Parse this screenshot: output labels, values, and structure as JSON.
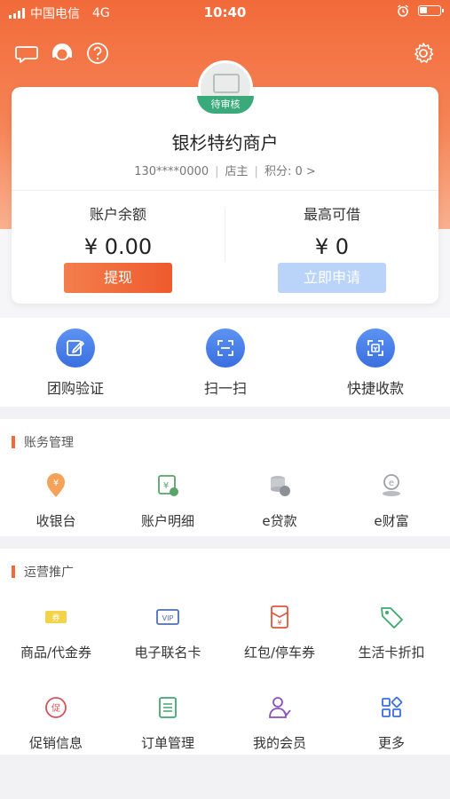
{
  "status_bar": {
    "carrier": "中国电信",
    "network": "4G",
    "time": "10:40"
  },
  "merchant": {
    "badge": "待审核",
    "name": "银杉特约商户",
    "phone": "130****0000",
    "role": "店主",
    "points": "积分: 0 >"
  },
  "balance": {
    "account_label": "账户余额",
    "account_value": "¥ 0.00",
    "withdraw_label": "提现",
    "credit_label": "最高可借",
    "credit_value": "¥ 0",
    "apply_label": "立即申请"
  },
  "quick_actions": [
    {
      "label": "团购验证",
      "icon": "edit-icon"
    },
    {
      "label": "扫一扫",
      "icon": "scan-icon"
    },
    {
      "label": "快捷收款",
      "icon": "qr-pay-icon"
    }
  ],
  "finance": {
    "title": "账务管理",
    "items": [
      {
        "label": "收银台",
        "icon": "cashier-icon"
      },
      {
        "label": "账户明细",
        "icon": "account-detail-icon"
      },
      {
        "label": "e贷款",
        "icon": "loan-icon"
      },
      {
        "label": "e财富",
        "icon": "wealth-icon"
      }
    ]
  },
  "operations": {
    "title": "运营推广",
    "items": [
      {
        "label": "商品/代金券",
        "icon": "coupon-icon"
      },
      {
        "label": "电子联名卡",
        "icon": "vip-card-icon"
      },
      {
        "label": "红包/停车券",
        "icon": "red-packet-icon"
      },
      {
        "label": "生活卡折扣",
        "icon": "tag-icon"
      },
      {
        "label": "促销信息",
        "icon": "promo-icon"
      },
      {
        "label": "订单管理",
        "icon": "order-icon"
      },
      {
        "label": "我的会员",
        "icon": "member-icon"
      },
      {
        "label": "更多",
        "icon": "more-icon"
      }
    ]
  },
  "colors": {
    "brand": "#f26a3a",
    "primary_blue": "#3a6fe0",
    "badge_green": "#3aaa7c"
  }
}
